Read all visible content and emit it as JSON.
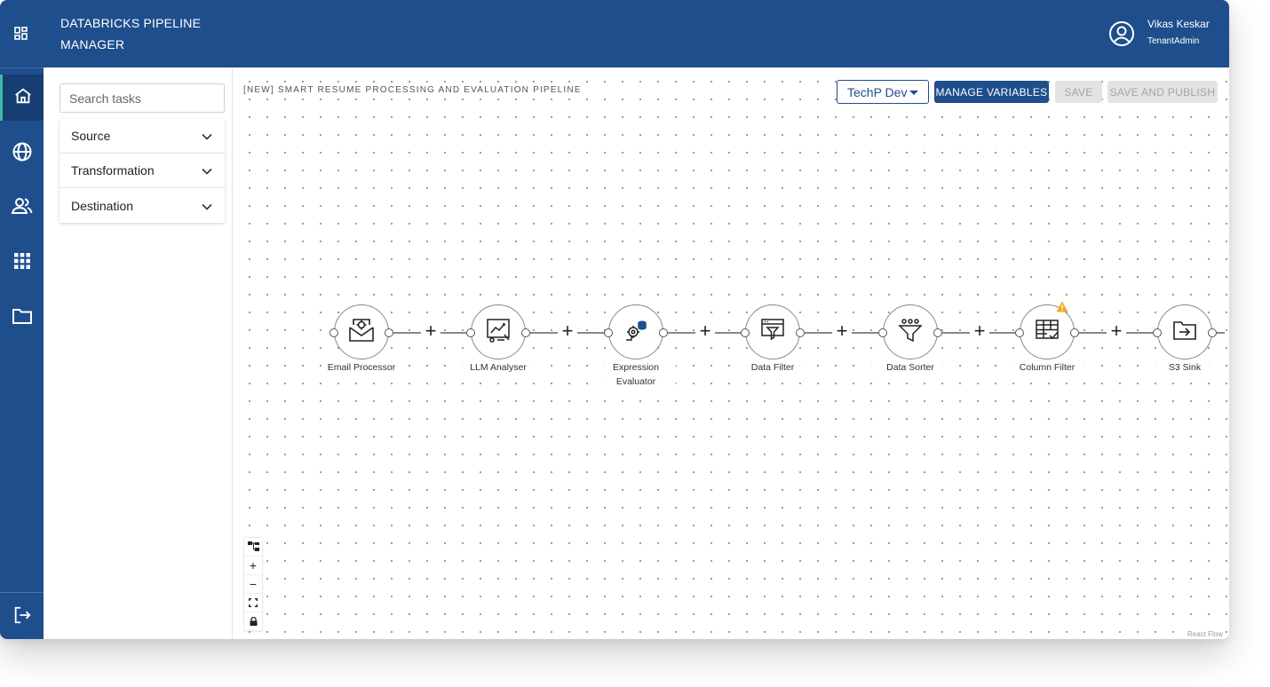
{
  "app": {
    "title": "DATABRICKS PIPELINE MANAGER",
    "user_name": "Vikas Keskar",
    "user_role": "TenantAdmin"
  },
  "rail": {
    "items": [
      {
        "icon": "home-icon",
        "active": true
      },
      {
        "icon": "globe-icon",
        "active": false
      },
      {
        "icon": "users-icon",
        "active": false
      },
      {
        "icon": "apps-grid-icon",
        "active": false
      },
      {
        "icon": "folder-icon",
        "active": false
      }
    ],
    "bottom_icon": "logout-icon"
  },
  "panel": {
    "search_placeholder": "Search tasks",
    "categories": [
      "Source",
      "Transformation",
      "Destination"
    ]
  },
  "canvas": {
    "pipeline_name": "[NEW] SMART RESUME PROCESSING AND EVALUATION PIPELINE",
    "environment": "TechP Dev",
    "manage_variables_label": "MANAGE VARIABLES",
    "save_label": "SAVE",
    "save_publish_label": "SAVE AND PUBLISH",
    "attribution": "React Flow",
    "nodes": [
      {
        "label": "Email Processor",
        "icon": "email-gear-icon",
        "warning": false
      },
      {
        "label": "LLM Analyser",
        "icon": "ai-chart-icon",
        "warning": false
      },
      {
        "label": "Expression Evaluator",
        "icon": "gears-database-icon",
        "warning": false
      },
      {
        "label": "Data Filter",
        "icon": "filter-window-icon",
        "warning": false
      },
      {
        "label": "Data Sorter",
        "icon": "funnel-sort-icon",
        "warning": false
      },
      {
        "label": "Column Filter",
        "icon": "table-check-icon",
        "warning": true
      },
      {
        "label": "S3 Sink",
        "icon": "folder-export-icon",
        "warning": false
      }
    ],
    "add_step_symbol": "+"
  },
  "colors": {
    "primary": "#1f4e8c",
    "accent": "#3fb8a8",
    "warning": "#f5a623",
    "disabled": "#e3e3e3"
  }
}
